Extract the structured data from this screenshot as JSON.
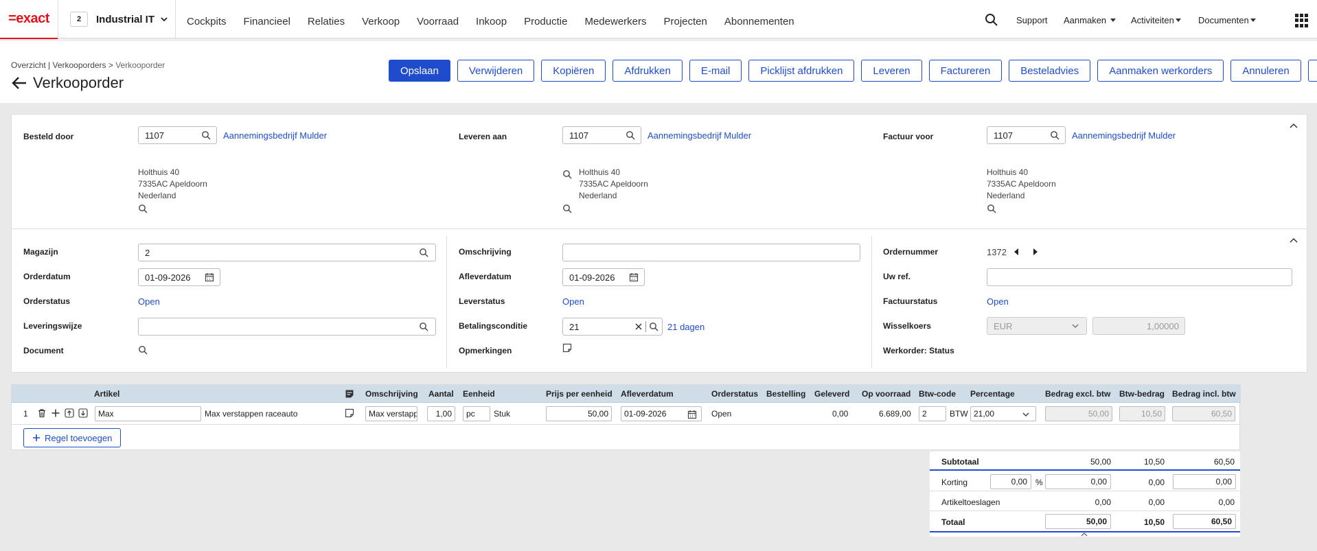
{
  "brand": {
    "logo_text": "=exact",
    "accent": "#e4131b"
  },
  "division": {
    "number": "2",
    "name": "Industrial IT"
  },
  "main_nav": [
    "Cockpits",
    "Financieel",
    "Relaties",
    "Verkoop",
    "Voorraad",
    "Inkoop",
    "Productie",
    "Medewerkers",
    "Projecten",
    "Abonnementen"
  ],
  "top_right": {
    "support": "Support",
    "create": "Aanmaken",
    "activities": "Activiteiten",
    "documents": "Documenten"
  },
  "breadcrumb": {
    "overview": "Overzicht",
    "sep1": " | ",
    "orders": "Verkooporders",
    "sep2": " > ",
    "current": "Verkooporder"
  },
  "page_title": "Verkooporder",
  "actions": {
    "save": "Opslaan",
    "delete": "Verwijderen",
    "copy": "Kopiëren",
    "print": "Afdrukken",
    "email": "E-mail",
    "picklist": "Picklijst afdrukken",
    "deliver": "Leveren",
    "invoice": "Factureren",
    "advice": "Besteladvies",
    "workorders": "Aanmaken werkorders",
    "cancel": "Annuleren"
  },
  "parties": {
    "ordered_by": {
      "label": "Besteld door",
      "code": "1107",
      "name": "Aannemingsbedrijf Mulder",
      "street": "Holthuis 40",
      "city": "7335AC Apeldoorn",
      "country": "Nederland"
    },
    "deliver_to": {
      "label": "Leveren aan",
      "code": "1107",
      "name": "Aannemingsbedrijf Mulder",
      "street": "Holthuis 40",
      "city": "7335AC Apeldoorn",
      "country": "Nederland"
    },
    "invoice_to": {
      "label": "Factuur voor",
      "code": "1107",
      "name": "Aannemingsbedrijf Mulder",
      "street": "Holthuis 40",
      "city": "7335AC Apeldoorn",
      "country": "Nederland"
    }
  },
  "details": {
    "warehouse_label": "Magazijn",
    "warehouse": "2",
    "order_date_label": "Orderdatum",
    "order_date": "01-09-2026",
    "order_status_label": "Orderstatus",
    "order_status": "Open",
    "delivery_method_label": "Leveringswijze",
    "delivery_method": "",
    "document_label": "Document",
    "description_label": "Omschrijving",
    "description": "",
    "delivery_date_label": "Afleverdatum",
    "delivery_date": "01-09-2026",
    "delivery_status_label": "Leverstatus",
    "delivery_status": "Open",
    "payment_label": "Betalingsconditie",
    "payment_code": "21",
    "payment_text": "21 dagen",
    "remarks_label": "Opmerkingen",
    "order_number_label": "Ordernummer",
    "order_number": "1372",
    "your_ref_label": "Uw ref.",
    "your_ref": "",
    "invoice_status_label": "Factuurstatus",
    "invoice_status": "Open",
    "exchange_label": "Wisselkoers",
    "currency": "EUR",
    "rate": "1,00000",
    "workorder_label": "Werkorder: Status"
  },
  "lines": {
    "headers": {
      "article": "Artikel",
      "description": "Omschrijving",
      "qty": "Aantal",
      "unit": "Eenheid",
      "price": "Prijs per eenheid",
      "delivery_date": "Afleverdatum",
      "status": "Orderstatus",
      "ordered": "Bestelling",
      "delivered": "Geleverd",
      "stock": "Op voorraad",
      "vat_code": "Btw-code",
      "percentage": "Percentage",
      "amount_excl": "Bedrag excl. btw",
      "vat_amount": "Btw-bedrag",
      "amount_incl": "Bedrag incl. btw"
    },
    "rows": [
      {
        "num": "1",
        "article_code": "Max",
        "article_name": "Max verstappen raceauto",
        "description": "Max verstappen raceauto",
        "qty": "1,00",
        "unit_code": "pc",
        "unit_name": "Stuk",
        "price": "50,00",
        "delivery_date": "01-09-2026",
        "status": "Open",
        "ordered": "",
        "delivered": "0,00",
        "stock": "6.689,00",
        "vat_code": "2",
        "vat_name": "BTW hoog",
        "percentage": "21,00",
        "amount_excl": "50,00",
        "vat_amount": "10,50",
        "amount_incl": "60,50"
      }
    ],
    "add_line": "Regel toevoegen"
  },
  "totals": {
    "subtotal_label": "Subtotaal",
    "subtotal_excl": "50,00",
    "subtotal_vat": "10,50",
    "subtotal_incl": "60,50",
    "discount_label": "Korting",
    "discount_pct": "0,00",
    "pct_sign": "%",
    "discount_excl": "0,00",
    "discount_vat": "0,00",
    "discount_incl": "0,00",
    "surcharge_label": "Artikeltoeslagen",
    "surcharge_excl": "0,00",
    "surcharge_vat": "0,00",
    "surcharge_incl": "0,00",
    "total_label": "Totaal",
    "total_excl": "50,00",
    "total_vat": "10,50",
    "total_incl": "60,50"
  },
  "icons": [
    "search-icon",
    "chevron-down-icon",
    "back-arrow-icon",
    "more-icon",
    "grid-menu-icon",
    "calendar-icon",
    "clear-icon",
    "note-icon",
    "trash-icon",
    "plus-icon",
    "move-up-icon",
    "move-down-icon",
    "caret-left-icon",
    "caret-right-icon",
    "collapse-icon"
  ]
}
